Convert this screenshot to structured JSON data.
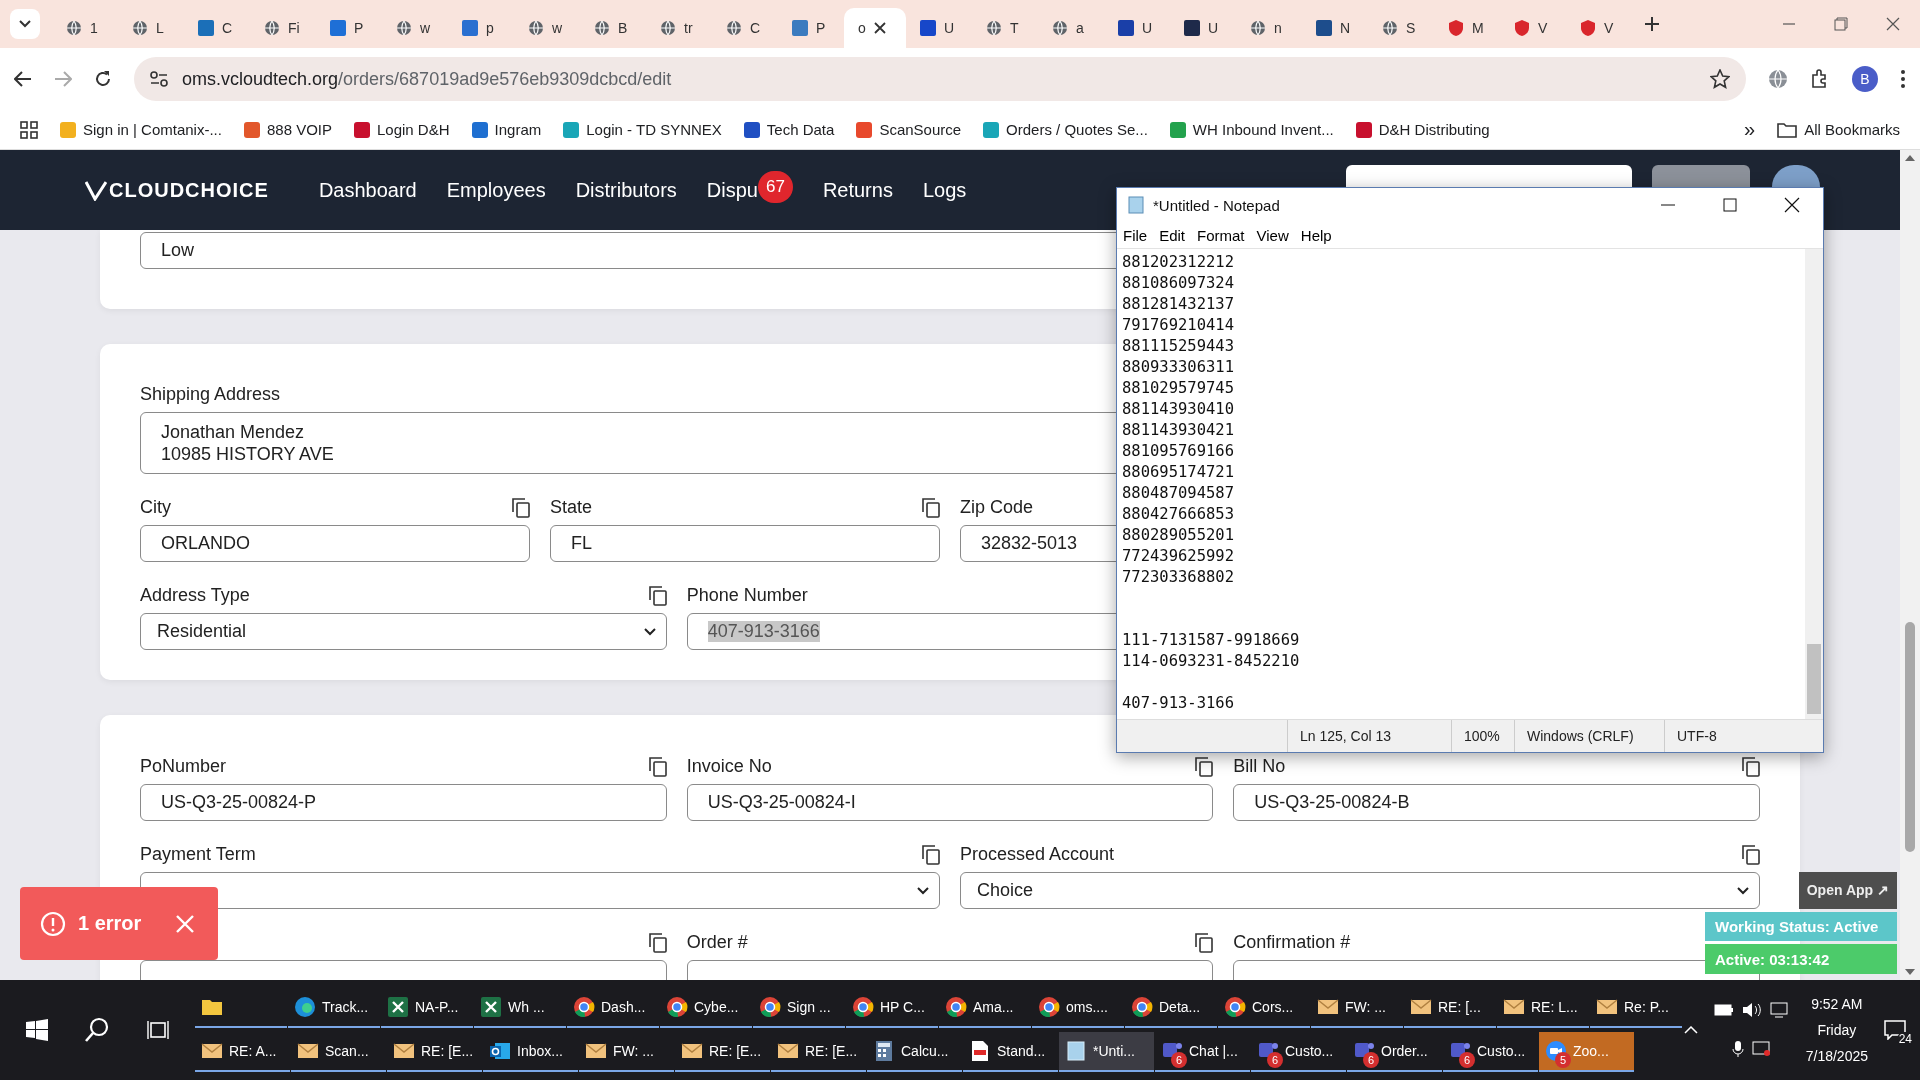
{
  "browser": {
    "tabs": [
      {
        "label": "1",
        "kind": "globe",
        "selected": false
      },
      {
        "label": "L",
        "kind": "globe",
        "selected": false
      },
      {
        "label": "C",
        "kind": "tile",
        "color": "#1b6fb8",
        "selected": false
      },
      {
        "label": "Fi",
        "kind": "globe",
        "selected": false
      },
      {
        "label": "P",
        "kind": "tile",
        "color": "#1e6fd6",
        "selected": false
      },
      {
        "label": "w",
        "kind": "globe",
        "selected": false
      },
      {
        "label": "p",
        "kind": "tile",
        "color": "#2a6fd0",
        "selected": false
      },
      {
        "label": "w",
        "kind": "globe",
        "selected": false
      },
      {
        "label": "B",
        "kind": "globe",
        "selected": false
      },
      {
        "label": "tr",
        "kind": "globe",
        "selected": false
      },
      {
        "label": "C",
        "kind": "globe",
        "selected": false
      },
      {
        "label": "P",
        "kind": "tile",
        "color": "#3b7bbf",
        "selected": false
      },
      {
        "label": "o",
        "kind": "blank",
        "selected": true
      },
      {
        "label": "U",
        "kind": "tile",
        "color": "#1747c9",
        "selected": false
      },
      {
        "label": "T",
        "kind": "globe",
        "selected": false
      },
      {
        "label": "a",
        "kind": "globe",
        "selected": false
      },
      {
        "label": "U",
        "kind": "tile",
        "color": "#1a3fa8",
        "selected": false
      },
      {
        "label": "U",
        "kind": "tile",
        "color": "#1e2a4a",
        "selected": false
      },
      {
        "label": "n",
        "kind": "globe",
        "selected": false
      },
      {
        "label": "N",
        "kind": "tile",
        "color": "#1d4d8c",
        "selected": false
      },
      {
        "label": "S",
        "kind": "globe",
        "selected": false
      },
      {
        "label": "M",
        "kind": "shield",
        "color": "#d9262c",
        "selected": false
      },
      {
        "label": "V",
        "kind": "shield",
        "color": "#d9262c",
        "selected": false
      },
      {
        "label": "V",
        "kind": "shield",
        "color": "#d9262c",
        "selected": false
      }
    ],
    "url_host": "oms.vcloudtech.org",
    "url_path": "/orders/687019ad9e576eb9309dcbcd/edit",
    "profile": "B",
    "bookmarks": [
      {
        "label": "Sign in | Comtanix-...",
        "color": "#f2b01e"
      },
      {
        "label": "888 VOIP",
        "color": "#e2572b"
      },
      {
        "label": "Login D&H",
        "color": "#c8102e"
      },
      {
        "label": "Ingram",
        "color": "#1f6fd1"
      },
      {
        "label": "Login - TD SYNNEX",
        "color": "#1aa6b7"
      },
      {
        "label": "Tech Data",
        "color": "#1f4fc2"
      },
      {
        "label": "ScanSource",
        "color": "#e8492c"
      },
      {
        "label": "Orders / Quotes Se...",
        "color": "#1aa6b7"
      },
      {
        "label": "WH Inbound Invent...",
        "color": "#23a24d"
      },
      {
        "label": "D&H Distributing",
        "color": "#c8102e"
      }
    ],
    "more_bookmarks": "»",
    "all_bookmarks": "All Bookmarks"
  },
  "app": {
    "logo": "CLOUDCHOICE",
    "nav": [
      {
        "label": "Dashboard"
      },
      {
        "label": "Employees"
      },
      {
        "label": "Distributors"
      },
      {
        "label": "Dispu",
        "badge": "67"
      },
      {
        "label": "Returns"
      },
      {
        "label": "Logs"
      }
    ],
    "sections": [
      {
        "rows": [
          {
            "kind": "full",
            "fields": [
              {
                "kind": "input",
                "value": "Low",
                "copy": false
              }
            ]
          }
        ]
      },
      {
        "rows": [
          {
            "kind": "full",
            "fields": [
              {
                "label": "Shipping Address",
                "kind": "textarea",
                "value": "Jonathan Mendez\n10985 HISTORY AVE",
                "copy": false
              }
            ]
          },
          {
            "kind": "quarter",
            "fields": [
              {
                "label": "City",
                "kind": "input",
                "value": "ORLANDO",
                "copy": true
              },
              {
                "label": "State",
                "kind": "input",
                "value": "FL",
                "copy": true
              },
              {
                "label": "Zip Code",
                "kind": "input",
                "value": "32832-5013",
                "copy": false
              }
            ]
          },
          {
            "kind": "third",
            "fields": [
              {
                "label": "Address Type",
                "kind": "select",
                "value": "Residential",
                "copy": true
              },
              {
                "label": "Phone Number",
                "kind": "input",
                "value": "407-913-3166",
                "copy": false,
                "text_selected": true
              }
            ]
          }
        ]
      },
      {
        "rows": [
          {
            "kind": "third",
            "fields": [
              {
                "label": "PoNumber",
                "kind": "input",
                "value": "US-Q3-25-00824-P",
                "copy": true
              },
              {
                "label": "Invoice No",
                "kind": "input",
                "value": "US-Q3-25-00824-I",
                "copy": true
              },
              {
                "label": "Bill No",
                "kind": "input",
                "value": "US-Q3-25-00824-B",
                "copy": true
              }
            ]
          },
          {
            "kind": "half",
            "fields": [
              {
                "label": "Payment Term",
                "kind": "select",
                "copy": true
              },
              {
                "label": "Processed Account",
                "kind": "select",
                "value": "Choice",
                "copy": true
              }
            ]
          },
          {
            "kind": "third",
            "fields": [
              {
                "kind": "input",
                "copy": true
              },
              {
                "label": "Order #",
                "kind": "input",
                "copy": true
              },
              {
                "label": "Confirmation #",
                "kind": "input",
                "copy": false
              }
            ]
          }
        ]
      }
    ]
  },
  "notepad": {
    "title": "*Untitled - Notepad",
    "menu": [
      "File",
      "Edit",
      "Format",
      "View",
      "Help"
    ],
    "text": "881202312212\n881086097324\n881281432137\n791769210414\n881115259443\n880933306311\n881029579745\n881143930410\n881143930421\n881095769166\n880695174721\n880487094587\n880427666853\n880289055201\n772439625992\n772303368802\n\n\n111-7131587-9918669\n114-0693231-8452210\n\n407-913-3166",
    "status": [
      "Ln 125, Col 13",
      "100%",
      "Windows (CRLF)",
      "UTF-8"
    ]
  },
  "toast": {
    "text": "1 error"
  },
  "tracker": {
    "open": "Open App ↗",
    "status": "Working Status: Active",
    "timer": "Active: 03:13:42"
  },
  "taskbar": {
    "rows": [
      [
        {
          "kind": "folder"
        },
        {
          "kind": "edge",
          "label": "Track..."
        },
        {
          "kind": "excel",
          "label": "NA-P..."
        },
        {
          "kind": "excel",
          "label": "Wh ..."
        },
        {
          "kind": "chrome",
          "label": "Dash..."
        },
        {
          "kind": "chrome",
          "label": "Cybe..."
        },
        {
          "kind": "chrome",
          "label": "Sign ..."
        },
        {
          "kind": "chrome",
          "label": "HP C..."
        },
        {
          "kind": "chrome",
          "label": "Ama..."
        },
        {
          "kind": "chrome",
          "label": "oms...."
        },
        {
          "kind": "chrome",
          "label": "Deta..."
        },
        {
          "kind": "chrome",
          "label": "Cors..."
        },
        {
          "kind": "mail",
          "label": "FW: ..."
        },
        {
          "kind": "mail",
          "label": "RE: [..."
        },
        {
          "kind": "mail",
          "label": "RE: L..."
        },
        {
          "kind": "mail",
          "label": "Re: P..."
        }
      ],
      [
        {
          "kind": "mail",
          "label": "RE: A..."
        },
        {
          "kind": "mail",
          "label": "Scan..."
        },
        {
          "kind": "mail",
          "label": "RE: [E..."
        },
        {
          "kind": "outlook",
          "label": "Inbox..."
        },
        {
          "kind": "mail",
          "label": "FW: ..."
        },
        {
          "kind": "mail",
          "label": "RE: [E..."
        },
        {
          "kind": "mail",
          "label": "RE: [E..."
        },
        {
          "kind": "calc",
          "label": "Calcu..."
        },
        {
          "kind": "pdf",
          "label": "Stand..."
        },
        {
          "kind": "notepad",
          "label": "*Unti...",
          "active": true
        },
        {
          "kind": "teams",
          "label": "Chat |...",
          "badge": "6"
        },
        {
          "kind": "teams",
          "label": "Custo...",
          "badge": "6"
        },
        {
          "kind": "teams",
          "label": "Order...",
          "badge": "6"
        },
        {
          "kind": "teams",
          "label": "Custo...",
          "badge": "6"
        },
        {
          "kind": "zoom",
          "label": "Zoo...",
          "badge": "5",
          "flashing": true
        }
      ]
    ],
    "time": "9:52 AM",
    "day": "Friday",
    "date": "7/18/2025",
    "notifications": "24"
  }
}
